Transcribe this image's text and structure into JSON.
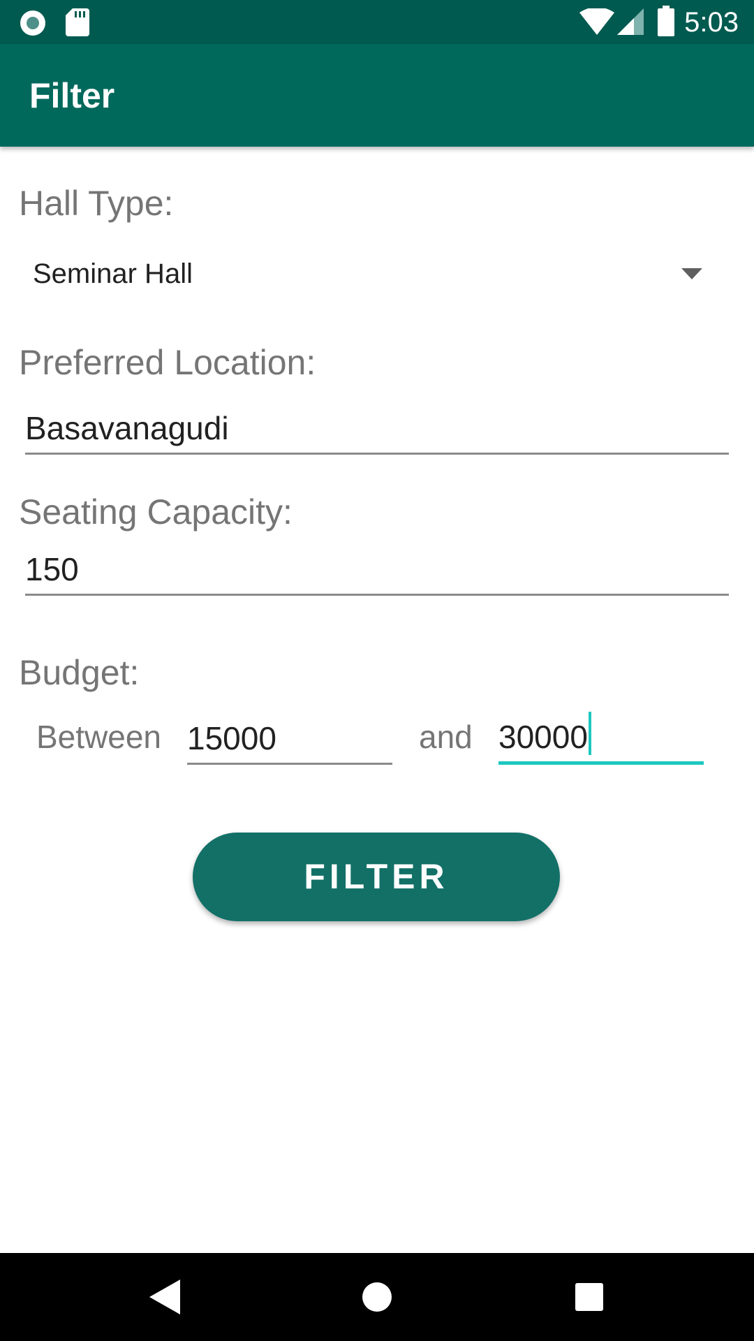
{
  "status_bar": {
    "time": "5:03",
    "icons": [
      "record-icon",
      "sd-card-icon",
      "wifi-icon",
      "signal-icon",
      "battery-icon"
    ]
  },
  "app_bar": {
    "title": "Filter",
    "background_color": "#00695c"
  },
  "hall_type": {
    "label": "Hall Type:",
    "selected": "Seminar Hall"
  },
  "location": {
    "label": "Preferred Location:",
    "value": "Basavanagudi"
  },
  "seating": {
    "label": "Seating Capacity:",
    "value": "150"
  },
  "budget": {
    "label": "Budget:",
    "between_label": "Between",
    "min_value": "15000",
    "and_label": "and",
    "max_value": "30000"
  },
  "filter_button": {
    "label": "FILTER",
    "color": "#127067"
  },
  "nav_bar": {
    "buttons": [
      "back-icon",
      "home-icon",
      "recents-icon"
    ]
  },
  "colors": {
    "accent": "#1ec8bf",
    "label_gray": "#757575"
  }
}
